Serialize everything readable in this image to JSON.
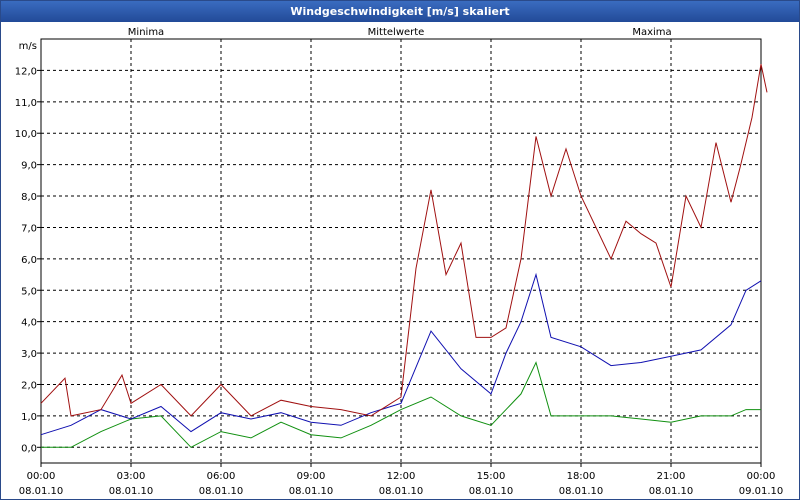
{
  "window": {
    "title": "Windgeschwindigkeit [m/s] skaliert"
  },
  "chart_data": {
    "type": "line",
    "title": "Windgeschwindigkeit [m/s] skaliert",
    "ylabel": "m/s",
    "ylim": [
      -0.5,
      13.0
    ],
    "yticks": [
      0.0,
      1.0,
      2.0,
      3.0,
      4.0,
      5.0,
      6.0,
      7.0,
      8.0,
      9.0,
      10.0,
      11.0,
      12.0
    ],
    "ytick_labels": [
      "0,0",
      "1,0",
      "2,0",
      "3,0",
      "4,0",
      "5,0",
      "6,0",
      "7,0",
      "8,0",
      "9,0",
      "10,0",
      "11,0",
      "12,0"
    ],
    "x_hours": [
      0,
      3,
      6,
      9,
      12,
      15,
      18,
      21,
      24
    ],
    "xtick_time_labels": [
      "00:00",
      "03:00",
      "06:00",
      "09:00",
      "12:00",
      "15:00",
      "18:00",
      "21:00",
      "00:00"
    ],
    "xtick_date_labels": [
      "08.01.10",
      "08.01.10",
      "08.01.10",
      "08.01.10",
      "08.01.10",
      "08.01.10",
      "08.01.10",
      "08.01.10",
      "09.01.10"
    ],
    "grid": true,
    "legend_position": "top",
    "series": [
      {
        "name": "Minima",
        "color": "#109010",
        "points": [
          [
            0,
            0
          ],
          [
            1,
            0
          ],
          [
            2,
            0.5
          ],
          [
            3,
            0.9
          ],
          [
            4,
            1
          ],
          [
            5,
            0
          ],
          [
            6,
            0.5
          ],
          [
            7,
            0.3
          ],
          [
            8,
            0.8
          ],
          [
            9,
            0.4
          ],
          [
            10,
            0.3
          ],
          [
            11,
            0.7
          ],
          [
            12,
            1.2
          ],
          [
            13,
            1.6
          ],
          [
            14,
            1
          ],
          [
            15,
            0.7
          ],
          [
            16,
            1.7
          ],
          [
            16.5,
            2.7
          ],
          [
            17,
            1
          ],
          [
            18,
            1
          ],
          [
            19,
            1
          ],
          [
            20,
            0.9
          ],
          [
            21,
            0.8
          ],
          [
            22,
            1
          ],
          [
            23,
            1
          ],
          [
            23.5,
            1.2
          ],
          [
            24,
            1.2
          ]
        ]
      },
      {
        "name": "Mittelwerte",
        "color": "#1010b0",
        "points": [
          [
            0,
            0.4
          ],
          [
            1,
            0.7
          ],
          [
            2,
            1.2
          ],
          [
            3,
            0.9
          ],
          [
            4,
            1.3
          ],
          [
            5,
            0.5
          ],
          [
            6,
            1.1
          ],
          [
            7,
            0.9
          ],
          [
            8,
            1.1
          ],
          [
            9,
            0.8
          ],
          [
            10,
            0.7
          ],
          [
            11,
            1.1
          ],
          [
            12,
            1.4
          ],
          [
            13,
            3.7
          ],
          [
            14,
            2.5
          ],
          [
            15,
            1.7
          ],
          [
            15.5,
            3
          ],
          [
            16,
            4
          ],
          [
            16.5,
            5.5
          ],
          [
            17,
            3.5
          ],
          [
            18,
            3.2
          ],
          [
            19,
            2.6
          ],
          [
            20,
            2.7
          ],
          [
            21,
            2.9
          ],
          [
            22,
            3.1
          ],
          [
            23,
            3.9
          ],
          [
            23.5,
            5
          ],
          [
            24,
            5.3
          ]
        ]
      },
      {
        "name": "Maxima",
        "color": "#a01010",
        "points": [
          [
            0,
            1.4
          ],
          [
            0.8,
            2.2
          ],
          [
            1,
            1
          ],
          [
            2,
            1.2
          ],
          [
            2.7,
            2.3
          ],
          [
            3,
            1.4
          ],
          [
            4,
            2
          ],
          [
            5,
            1
          ],
          [
            6,
            2
          ],
          [
            7,
            1
          ],
          [
            8,
            1.5
          ],
          [
            9,
            1.3
          ],
          [
            10,
            1.2
          ],
          [
            11,
            1
          ],
          [
            12,
            1.6
          ],
          [
            12.5,
            5.7
          ],
          [
            13,
            8.2
          ],
          [
            13.5,
            5.5
          ],
          [
            14,
            6.5
          ],
          [
            14.5,
            3.5
          ],
          [
            15,
            3.5
          ],
          [
            15.5,
            3.8
          ],
          [
            16,
            6
          ],
          [
            16.5,
            9.9
          ],
          [
            17,
            8
          ],
          [
            17.5,
            9.5
          ],
          [
            18,
            8
          ],
          [
            19,
            6
          ],
          [
            19.5,
            7.2
          ],
          [
            20,
            6.8
          ],
          [
            20.5,
            6.5
          ],
          [
            21,
            5.1
          ],
          [
            21.5,
            8
          ],
          [
            22,
            7
          ],
          [
            22.5,
            9.7
          ],
          [
            23,
            7.8
          ],
          [
            23.3,
            8.9
          ],
          [
            23.7,
            10.5
          ],
          [
            24,
            12.2
          ],
          [
            24.2,
            11.3
          ]
        ]
      }
    ]
  }
}
